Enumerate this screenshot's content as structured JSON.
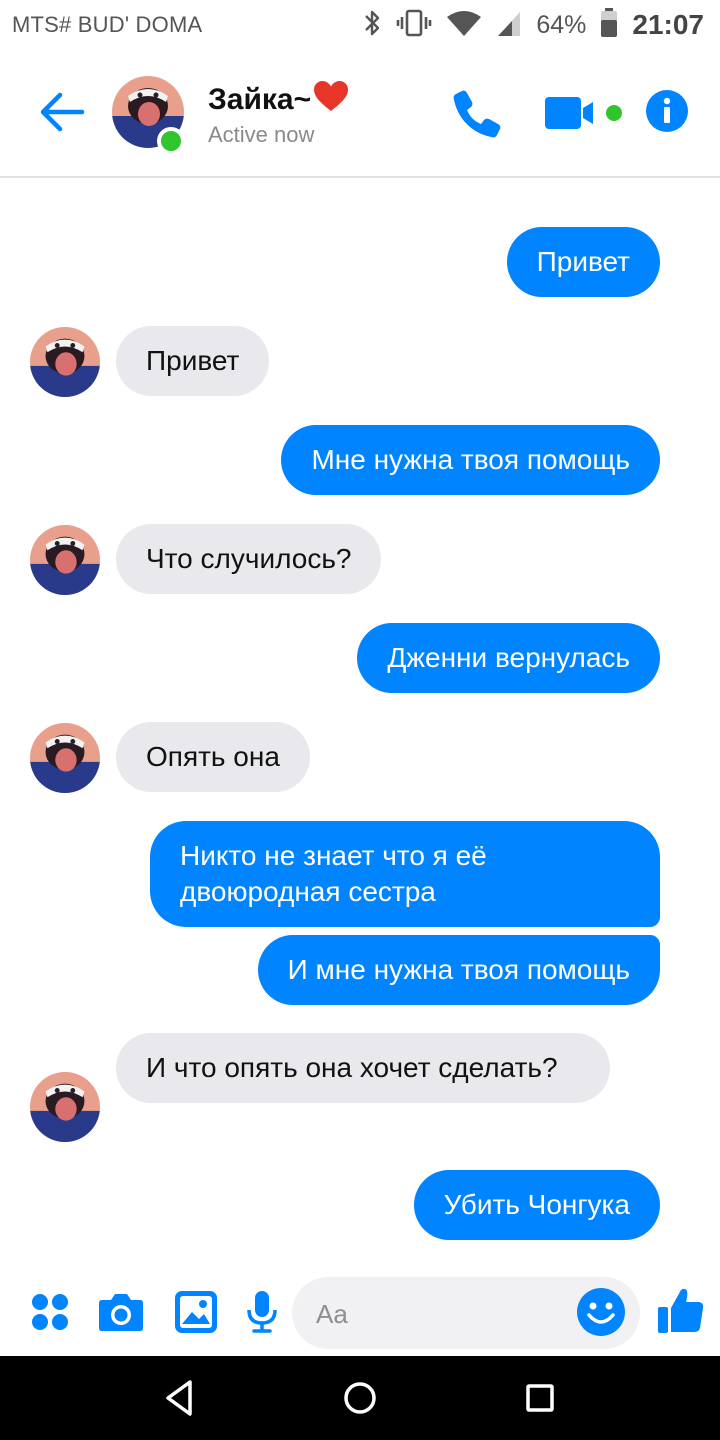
{
  "status_bar": {
    "carrier": "MTS# BUD' DOMA",
    "battery": "64%",
    "time": "21:07",
    "icons": [
      "bluetooth-icon",
      "vibrate-icon",
      "wifi-icon",
      "signal-icon",
      "battery-icon"
    ]
  },
  "header": {
    "contact_name": "Зайка~",
    "status": "Active now",
    "online": true,
    "icons": [
      "back-arrow-icon",
      "phone-icon",
      "video-camera-icon",
      "info-icon",
      "heart-emoji"
    ]
  },
  "messages": [
    {
      "dir": "out",
      "text": "Привет"
    },
    {
      "dir": "in",
      "text": "Привет"
    },
    {
      "dir": "out",
      "text": "Мне нужна твоя помощь"
    },
    {
      "dir": "in",
      "text": "Что случилось?"
    },
    {
      "dir": "out",
      "text": "Дженни вернулась"
    },
    {
      "dir": "in",
      "text": "Опять она"
    },
    {
      "dir": "out",
      "text": "Никто не знает что я её двоюродная сестра"
    },
    {
      "dir": "out",
      "text": "И мне нужна твоя помощь"
    },
    {
      "dir": "in",
      "text": "И что опять она хочет сделать?"
    },
    {
      "dir": "out",
      "text": "Убить Чонгука"
    }
  ],
  "composer": {
    "placeholder": "Aa",
    "icons": [
      "apps-icon",
      "camera-icon",
      "image-icon",
      "microphone-icon",
      "emoji-icon",
      "thumbs-up-icon"
    ]
  },
  "colors": {
    "accent": "#0084ff",
    "outgoing_bubble": "#0084ff",
    "incoming_bubble": "#e9e8ed",
    "online": "#2fc52c"
  }
}
